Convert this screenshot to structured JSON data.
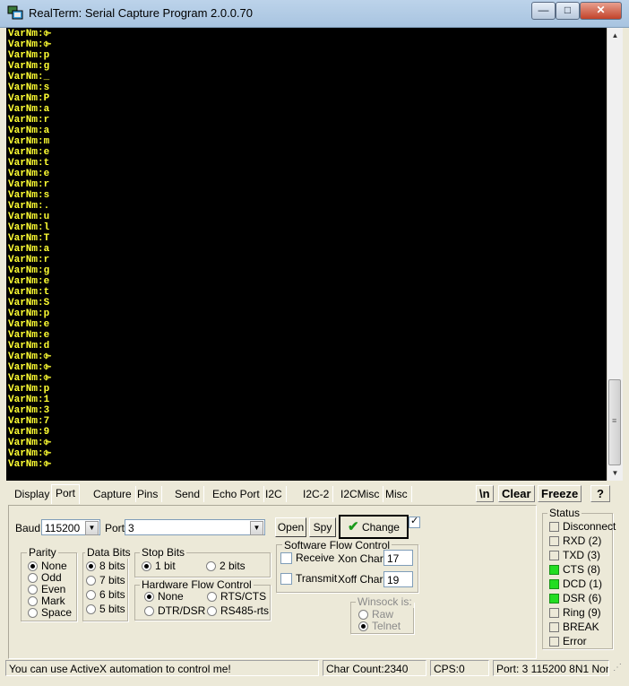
{
  "window": {
    "title": "RealTerm: Serial Capture Program 2.0.0.70",
    "minimize_glyph": "—",
    "maximize_glyph": "□",
    "close_glyph": "✕"
  },
  "terminal": {
    "prefix": "VarNm:",
    "values": [
      "⌱",
      "⌱",
      "p",
      "g",
      "_",
      "s",
      "P",
      "a",
      "r",
      "a",
      "m",
      "e",
      "t",
      "e",
      "r",
      "s",
      ".",
      "u",
      "l",
      "T",
      "a",
      "r",
      "g",
      "e",
      "t",
      "S",
      "p",
      "e",
      "e",
      "d",
      "⌱",
      "⌱",
      "⌱",
      "p",
      "1",
      "3",
      "7",
      "9",
      "⌱",
      "⌱",
      "⌱"
    ]
  },
  "tabs": [
    "Display",
    "Port",
    "Capture",
    "Pins",
    "Send",
    "Echo Port",
    "I2C",
    "I2C-2",
    "I2CMisc",
    "Misc"
  ],
  "active_tab": "Port",
  "toolbar": {
    "newline": "\\n",
    "clear": "Clear",
    "freeze": "Freeze",
    "help": "?"
  },
  "port": {
    "baud_label": "Baud",
    "baud_value": "115200",
    "port_label": "Port",
    "port_value": "3",
    "open_label": "Open",
    "spy_label": "Spy",
    "change_label": "Change",
    "change_checked": true
  },
  "parity": {
    "title": "Parity",
    "options": [
      "None",
      "Odd",
      "Even",
      "Mark",
      "Space"
    ],
    "selected": "None"
  },
  "data_bits": {
    "title": "Data Bits",
    "options": [
      "8 bits",
      "7 bits",
      "6 bits",
      "5 bits"
    ],
    "selected": "8 bits"
  },
  "stop_bits": {
    "title": "Stop Bits",
    "options": [
      "1 bit",
      "2 bits"
    ],
    "selected": "1 bit"
  },
  "hw_flow": {
    "title": "Hardware Flow Control",
    "options": [
      "None",
      "RTS/CTS",
      "DTR/DSR",
      "RS485-rts"
    ],
    "selected": "None"
  },
  "sw_flow": {
    "title": "Software Flow Control",
    "receive_label": "Receive",
    "transmit_label": "Transmit",
    "xon_label": "Xon Char:",
    "xon_value": "17",
    "xoff_label": "Xoff Char:",
    "xoff_value": "19"
  },
  "winsock": {
    "title": "Winsock is:",
    "options": [
      "Raw",
      "Telnet"
    ],
    "selected": "Telnet"
  },
  "status": {
    "title": "Status",
    "items": [
      {
        "label": "Disconnect",
        "on": false
      },
      {
        "label": "RXD (2)",
        "on": false
      },
      {
        "label": "TXD (3)",
        "on": false
      },
      {
        "label": "CTS (8)",
        "on": true
      },
      {
        "label": "DCD (1)",
        "on": true
      },
      {
        "label": "DSR (6)",
        "on": true
      },
      {
        "label": "Ring (9)",
        "on": false
      },
      {
        "label": "BREAK",
        "on": false
      },
      {
        "label": "Error",
        "on": false
      }
    ],
    "on_color": "#22dd22"
  },
  "statusbar": {
    "message": "You can use ActiveX automation to control me!",
    "char_count": "Char Count:2340",
    "cps": "CPS:0",
    "port_info": "Port: 3 115200 8N1 Non"
  }
}
